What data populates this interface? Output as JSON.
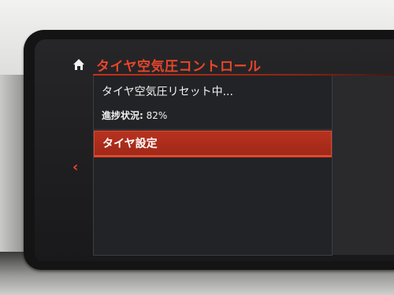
{
  "header": {
    "title": "タイヤ空気圧コントロール",
    "home_icon": "home-icon"
  },
  "status": {
    "message": "タイヤ空気圧リセット中...",
    "progress_label": "進捗状況:",
    "progress_value": "82%",
    "progress_fraction": 0.82
  },
  "menu": {
    "items": [
      {
        "label": "タイヤ設定",
        "selected": true
      }
    ]
  },
  "nav": {
    "back_icon": "chevron-left-icon",
    "back_glyph": "‹"
  },
  "colors": {
    "accent": "#e8452a",
    "selection": "#b8321f",
    "screen_bg": "#222326",
    "text": "#f2f2f2"
  }
}
